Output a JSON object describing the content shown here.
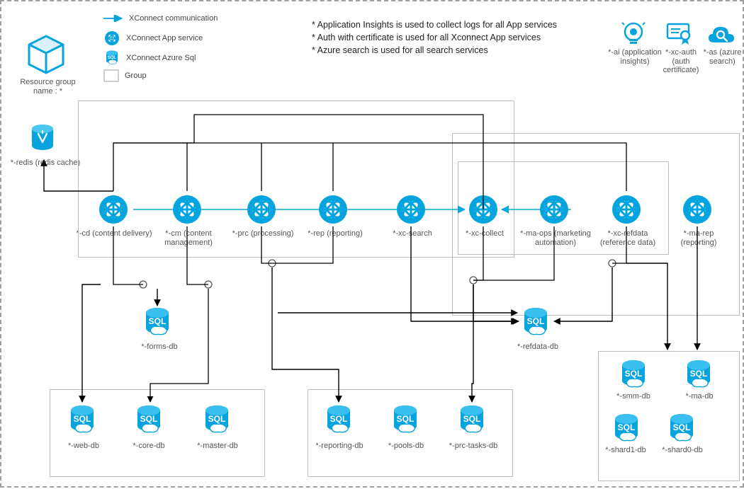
{
  "title": "Resource group name : *",
  "legend": {
    "xconnect_comm": "XConnect communication",
    "xconnect_app": "XConnect App service",
    "xconnect_sql": "XConnect Azure Sql",
    "group": "Group"
  },
  "notes": {
    "line1": "* Application Insights is used to collect logs for all App services",
    "line2": "* Auth with certificate is used for all Xconnect App services",
    "line3": "* Azure search is used for all search services"
  },
  "top_right": {
    "ai": "*-ai (application insights)",
    "xc_auth": "*-xc-auth (auth certificate)",
    "as": "*-as (azure search)"
  },
  "redis": "*-redis (redis cache)",
  "services": {
    "cd": "*-cd (content delivery)",
    "cm": "*-cm (content management)",
    "prc": "*-prc (processing)",
    "rep": "*-rep (reporting)",
    "xc_search": "*-xc-search",
    "xc_collect": "*-xc-collect",
    "ma_ops": "*-ma-ops (marketing automation)",
    "xc_refdata": "*-xc-refdata (reference data)",
    "ma_rep": "*-ma-rep (reporting)"
  },
  "dbs": {
    "forms": "*-forms-db",
    "refdata": "*-refdata-db",
    "web": "*-web-db",
    "core": "*-core-db",
    "master": "*-master-db",
    "reporting": "*-reporting-db",
    "pools": "*-pools-db",
    "prc_tasks": "*-prc-tasks-db",
    "smm": "*-smm-db",
    "ma": "*-ma-db",
    "shard1": "*-shard1-db",
    "shard0": "*-shard0-db"
  }
}
